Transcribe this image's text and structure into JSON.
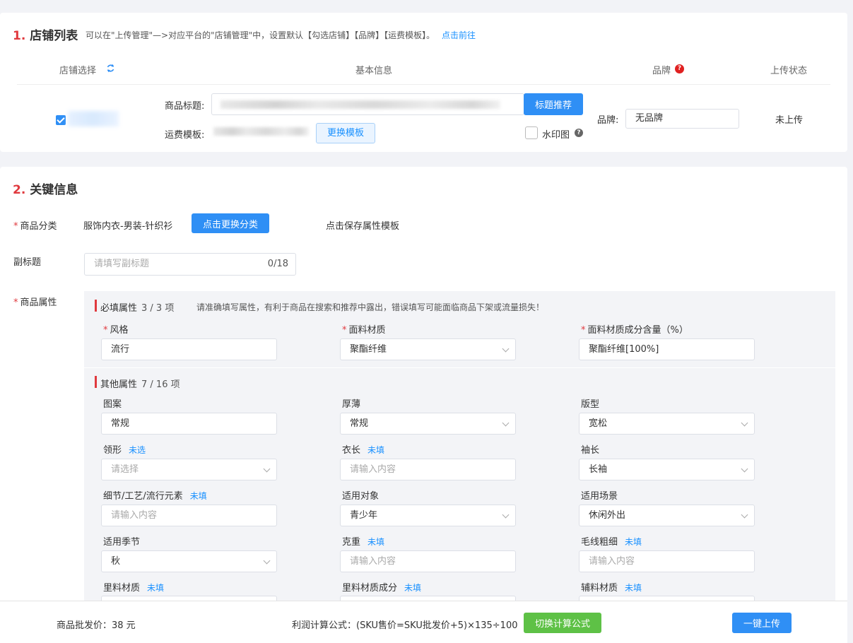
{
  "shop_section": {
    "number": "1.",
    "title": "店铺列表",
    "hint": "可以在\"上传管理\"—>对应平台的\"店铺管理\"中，设置默认【勾选店铺】【品牌】【运费模板】。",
    "hint_link": "点击前往",
    "columns": {
      "shop_select": "店铺选择",
      "basic_info": "基本信息",
      "brand": "品牌",
      "upload_status": "上传状态"
    },
    "row": {
      "checked": true,
      "product_title_label": "商品标题:",
      "title_recommend_button": "标题推荐",
      "shipping_template_label": "运费模板:",
      "change_template_button": "更换模板",
      "watermark_label": "水印图",
      "brand_label": "品牌:",
      "brand_value": "无品牌",
      "status": "未上传"
    }
  },
  "key_section": {
    "number": "2.",
    "title": "关键信息",
    "category_label": "商品分类",
    "category_value": "服饰内衣-男装-针织衫",
    "change_category_button": "点击更换分类",
    "save_template_link": "点击保存属性模板",
    "subtitle_label": "副标题",
    "subtitle_placeholder": "请填写副标题",
    "subtitle_counter": "0/18",
    "attributes_label": "商品属性",
    "required_group": {
      "title": "必填属性",
      "count": "3 / 3 项",
      "note": "请准确填写属性，有利于商品在搜索和推荐中露出，错误填写可能面临商品下架或流量损失！",
      "fields": [
        {
          "label": "风格",
          "value": "流行"
        },
        {
          "label": "面料材质",
          "value": "聚酯纤维"
        },
        {
          "label": "面料材质成分含量（%）",
          "value": "聚酯纤维[100%]"
        }
      ]
    },
    "other_group": {
      "title": "其他属性",
      "count": "7 / 16 项",
      "fields": [
        {
          "label": "图案",
          "tag": "",
          "value": "常规",
          "placeholder": ""
        },
        {
          "label": "厚薄",
          "tag": "",
          "value": "常规",
          "placeholder": ""
        },
        {
          "label": "版型",
          "tag": "",
          "value": "宽松",
          "placeholder": ""
        },
        {
          "label": "领形",
          "tag": "未选",
          "value": "",
          "placeholder": "请选择"
        },
        {
          "label": "衣长",
          "tag": "未填",
          "value": "",
          "placeholder": "请输入内容"
        },
        {
          "label": "袖长",
          "tag": "",
          "value": "长袖",
          "placeholder": ""
        },
        {
          "label": "细节/工艺/流行元素",
          "tag": "未填",
          "value": "",
          "placeholder": "请输入内容"
        },
        {
          "label": "适用对象",
          "tag": "",
          "value": "青少年",
          "placeholder": ""
        },
        {
          "label": "适用场景",
          "tag": "",
          "value": "休闲外出",
          "placeholder": ""
        },
        {
          "label": "适用季节",
          "tag": "",
          "value": "秋",
          "placeholder": ""
        },
        {
          "label": "克重",
          "tag": "未填",
          "value": "",
          "placeholder": "请输入内容"
        },
        {
          "label": "毛线粗细",
          "tag": "未填",
          "value": "",
          "placeholder": "请输入内容"
        },
        {
          "label": "里料材质",
          "tag": "未填",
          "value": "",
          "placeholder": ""
        },
        {
          "label": "里料材质成分",
          "tag": "未填",
          "value": "",
          "placeholder": ""
        },
        {
          "label": "辅料材质",
          "tag": "未填",
          "value": "",
          "placeholder": ""
        }
      ]
    }
  },
  "footer": {
    "wholesale_price": "商品批发价：38 元",
    "profit_formula": "利润计算公式：(SKU售价=SKU批发价+5)×135÷100",
    "switch_formula_button": "切换计算公式",
    "upload_button": "一键上传"
  },
  "colors": {
    "accent_red": "#e0393e",
    "primary_blue": "#2f8ff5",
    "link_blue": "#1890ff",
    "green": "#5ec146"
  }
}
